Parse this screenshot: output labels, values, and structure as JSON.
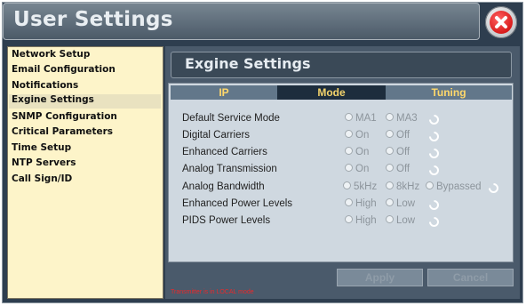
{
  "window": {
    "title": "User Settings",
    "close_icon": "close-icon"
  },
  "sidebar": {
    "items": [
      {
        "label": "Network Setup"
      },
      {
        "label": "Email Configuration"
      },
      {
        "label": "Notifications"
      },
      {
        "label": "Exgine Settings",
        "active": true
      },
      {
        "label": "SNMP Configuration"
      },
      {
        "label": "Critical Parameters"
      },
      {
        "label": "Time Setup"
      },
      {
        "label": "NTP Servers"
      },
      {
        "label": "Call Sign/ID"
      }
    ]
  },
  "section": {
    "title": "Exgine Settings"
  },
  "tabs": [
    {
      "label": "IP"
    },
    {
      "label": "Mode",
      "active": true
    },
    {
      "label": "Tuning"
    }
  ],
  "settings": [
    {
      "label": "Default Service Mode",
      "options": [
        "MA1",
        "MA3"
      ]
    },
    {
      "label": "Digital Carriers",
      "options": [
        "On",
        "Off"
      ]
    },
    {
      "label": "Enhanced Carriers",
      "options": [
        "On",
        "Off"
      ]
    },
    {
      "label": "Analog Transmission",
      "options": [
        "On",
        "Off"
      ]
    },
    {
      "label": "Analog Bandwidth",
      "options": [
        "5kHz",
        "8kHz",
        "Bypassed"
      ]
    },
    {
      "label": "Enhanced Power Levels",
      "options": [
        "High",
        "Low"
      ]
    },
    {
      "label": "PIDS Power Levels",
      "options": [
        "High",
        "Low"
      ]
    }
  ],
  "buttons": {
    "apply": "Apply",
    "cancel": "Cancel"
  },
  "status_text": "Transmitter is in LOCAL mode",
  "colors": {
    "tab_text": "#ffd86b",
    "status_red": "#e8292c",
    "sidebar_bg": "#fdf4c9",
    "window_bg": "#2e3e4f"
  }
}
